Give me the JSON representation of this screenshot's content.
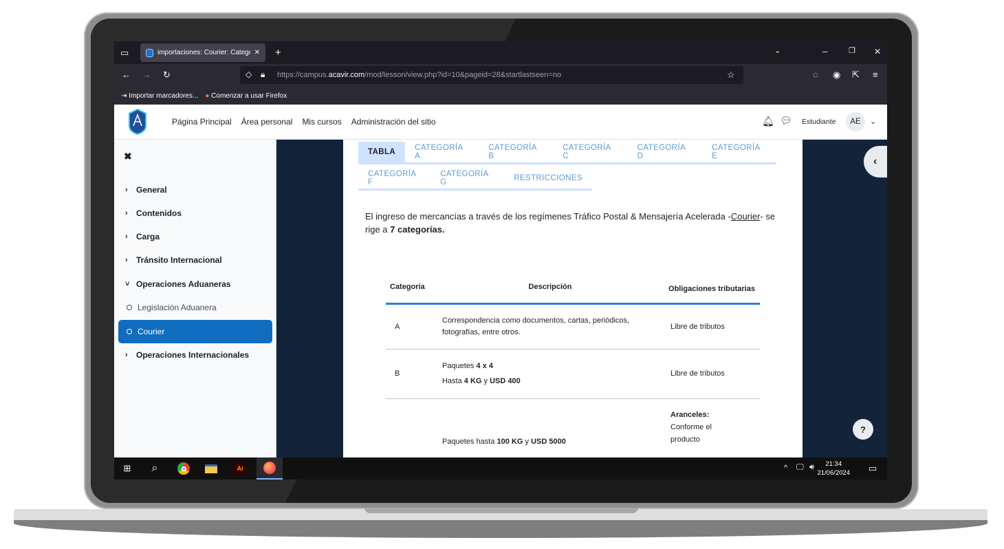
{
  "browser": {
    "tab_title": "importaciones: Courier: Catego",
    "tab_close": "✕",
    "new_tab": "+",
    "url_prefix": "https://campus.",
    "url_domain": "acavir.com",
    "url_path": "/mod/lesson/view.php?id=10&pageid=28&startlastseen=no",
    "bookmarks": [
      {
        "label": "Importar marcadores..."
      },
      {
        "label": "Comenzar a usar Firefox"
      }
    ]
  },
  "topnav": {
    "links": [
      "Página Principal",
      "Área personal",
      "Mis cursos",
      "Administración del sitio"
    ],
    "role": "Estudiante",
    "avatar": "AE"
  },
  "drawer": {
    "close": "✖",
    "items": [
      {
        "label": "General",
        "chev": "›"
      },
      {
        "label": "Contenidos",
        "chev": "›"
      },
      {
        "label": "Carga",
        "chev": "›"
      },
      {
        "label": "Tránsito Internacional",
        "chev": "›"
      },
      {
        "label": "Operaciones Aduaneras",
        "chev": "˅"
      },
      {
        "label": "Legislación Aduanera"
      },
      {
        "label": "Courier"
      },
      {
        "label": "Operaciones Internacionales",
        "chev": "›"
      }
    ]
  },
  "content": {
    "tabs_row1": [
      "TABLA",
      "CATEGORÍA A",
      "CATEGORÍA B",
      "CATEGORÍA C",
      "CATEGORÍA D",
      "CATEGORÍA E"
    ],
    "tabs_row2": [
      "CATEGORÍA F",
      "CATEGORÍA G",
      "RESTRICCIONES"
    ],
    "intro_a": "El ingreso de mercancías a través de los regímenes Tráfico Postal & Mensajería Acelerada -",
    "intro_link": "Courier",
    "intro_b": "- se rige a ",
    "intro_bold": "7 categorías.",
    "table": {
      "headers": [
        "Categoria",
        "Descripción",
        "Obligaciones tributarias"
      ],
      "rows": [
        {
          "cat": "A",
          "desc": "Correspondencia como documentos, cartas, periódicos, fotografías, entre otros.",
          "obl": "Libre de tributos"
        },
        {
          "cat": "B",
          "desc_1": "Paquetes ",
          "desc_1b": "4 x 4",
          "desc_2": "Hasta ",
          "desc_2b": "4 KG",
          "desc_2c": " y ",
          "desc_2d": "USD 400",
          "obl": "Libre de tributos"
        },
        {
          "desc_1": "Paquetes hasta ",
          "desc_1b": "100 KG",
          "desc_1c": " y ",
          "desc_1d": "USD 5000",
          "obl_b": "Aranceles:",
          "obl": "Conforme el producto"
        }
      ]
    },
    "help": "?"
  },
  "taskbar": {
    "time": "21:34",
    "date": "21/06/2024"
  }
}
